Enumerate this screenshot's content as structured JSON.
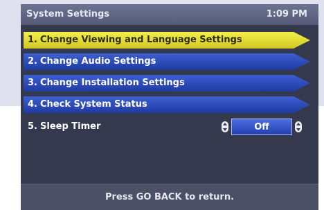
{
  "header": {
    "title": "System Settings",
    "time": "1:09 PM"
  },
  "menu": {
    "items": [
      {
        "number": "1.",
        "label": "Change Viewing and Language Settings",
        "selected": true
      },
      {
        "number": "2.",
        "label": "Change Audio Settings",
        "selected": false
      },
      {
        "number": "3.",
        "label": "Change Installation Settings",
        "selected": false
      },
      {
        "number": "4.",
        "label": "Check System Status",
        "selected": false
      }
    ],
    "sleep_timer": {
      "number": "5.",
      "label": "Sleep Timer",
      "value": "Off"
    }
  },
  "footer": {
    "text": "Press GO BACK to return."
  },
  "colors": {
    "selected": "#e5df36",
    "item": "#2d4cc0",
    "screen": "#35394e",
    "background": "#dfe1ee"
  },
  "icons": {
    "value_left": "updown-arrow-icon",
    "value_right": "updown-arrow-icon"
  }
}
